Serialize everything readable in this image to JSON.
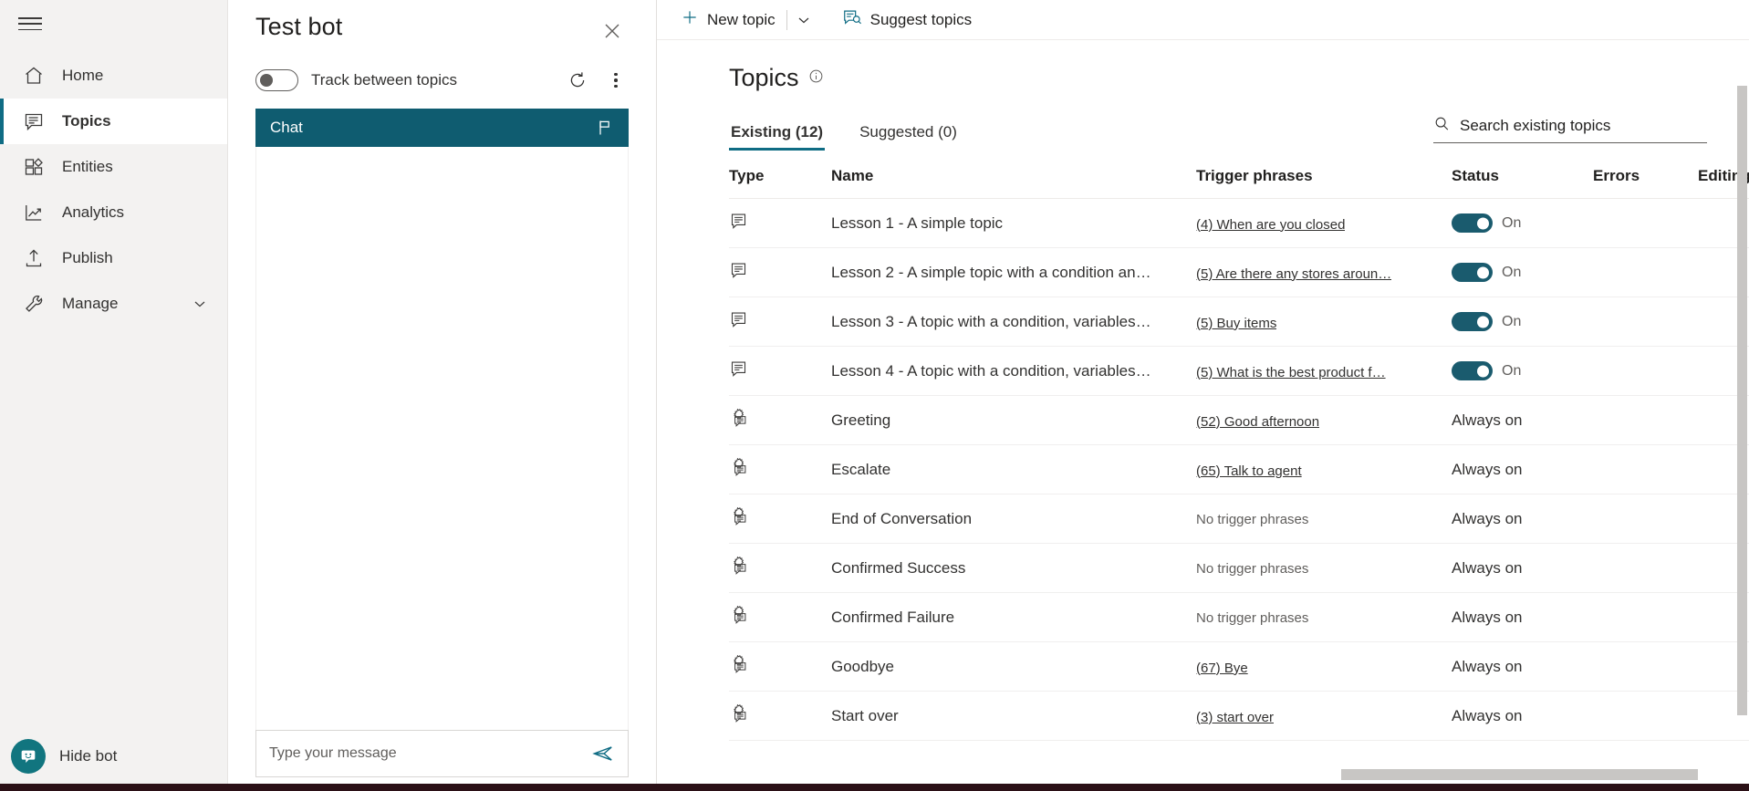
{
  "sidebar": {
    "menu_icon": "hamburger-icon",
    "items": [
      {
        "label": "Home",
        "icon": "home-icon"
      },
      {
        "label": "Topics",
        "icon": "chat-bubble-icon",
        "selected": true
      },
      {
        "label": "Entities",
        "icon": "entities-icon"
      },
      {
        "label": "Analytics",
        "icon": "analytics-icon"
      },
      {
        "label": "Publish",
        "icon": "publish-upload-icon"
      },
      {
        "label": "Manage",
        "icon": "wrench-icon",
        "chevron": "chevron-down-icon"
      }
    ],
    "hide_bot": {
      "label": "Hide bot",
      "icon": "bot-avatar-icon"
    }
  },
  "test_bot": {
    "title": "Test bot",
    "close_icon": "close-icon",
    "track_toggle": {
      "label": "Track between topics",
      "on": false
    },
    "refresh_icon": "refresh-icon",
    "more_icon": "more-vertical-icon",
    "chat_header": {
      "label": "Chat",
      "flag_icon": "flag-icon",
      "bg": "#0f5c70"
    },
    "input": {
      "placeholder": "Type your message",
      "value": "",
      "send_icon": "send-icon"
    }
  },
  "command_bar": {
    "new_topic": {
      "label": "New topic",
      "icon": "plus-icon"
    },
    "new_topic_caret": "chevron-down-icon",
    "suggest_topics": {
      "label": "Suggest topics",
      "icon": "suggest-topics-icon"
    }
  },
  "page": {
    "title": "Topics",
    "info_icon": "info-icon",
    "tabs": [
      {
        "label": "Existing (12)",
        "active": true
      },
      {
        "label": "Suggested (0)",
        "active": false
      }
    ],
    "search": {
      "placeholder": "Search existing topics",
      "value": "",
      "icon": "search-icon"
    }
  },
  "table": {
    "columns": [
      "Type",
      "Name",
      "Trigger phrases",
      "Status",
      "Errors",
      "Editing"
    ],
    "rows": [
      {
        "type_icon": "topic-icon",
        "name": "Lesson 1 - A simple topic",
        "trigger": "(4) When are you closed",
        "trigger_link": true,
        "status_kind": "toggle",
        "status_text": "On",
        "errors": "",
        "editing": ""
      },
      {
        "type_icon": "topic-icon",
        "name": "Lesson 2 - A simple topic with a condition an…",
        "trigger": "(5) Are there any stores aroun…",
        "trigger_link": true,
        "status_kind": "toggle",
        "status_text": "On",
        "errors": "",
        "editing": ""
      },
      {
        "type_icon": "topic-icon",
        "name": "Lesson 3 - A topic with a condition, variables…",
        "trigger": "(5) Buy items",
        "trigger_link": true,
        "status_kind": "toggle",
        "status_text": "On",
        "errors": "",
        "editing": ""
      },
      {
        "type_icon": "topic-icon",
        "name": "Lesson 4 - A topic with a condition, variables…",
        "trigger": "(5) What is the best product f…",
        "trigger_link": true,
        "status_kind": "toggle",
        "status_text": "On",
        "errors": "",
        "editing": ""
      },
      {
        "type_icon": "system-topic-icon",
        "name": "Greeting",
        "trigger": "(52) Good afternoon",
        "trigger_link": true,
        "status_kind": "text",
        "status_text": "Always on",
        "errors": "",
        "editing": ""
      },
      {
        "type_icon": "system-topic-icon",
        "name": "Escalate",
        "trigger": "(65) Talk to agent",
        "trigger_link": true,
        "status_kind": "text",
        "status_text": "Always on",
        "errors": "",
        "editing": ""
      },
      {
        "type_icon": "system-topic-icon",
        "name": "End of Conversation",
        "trigger": "No trigger phrases",
        "trigger_link": false,
        "status_kind": "text",
        "status_text": "Always on",
        "errors": "",
        "editing": ""
      },
      {
        "type_icon": "system-topic-icon",
        "name": "Confirmed Success",
        "trigger": "No trigger phrases",
        "trigger_link": false,
        "status_kind": "text",
        "status_text": "Always on",
        "errors": "",
        "editing": ""
      },
      {
        "type_icon": "system-topic-icon",
        "name": "Confirmed Failure",
        "trigger": "No trigger phrases",
        "trigger_link": false,
        "status_kind": "text",
        "status_text": "Always on",
        "errors": "",
        "editing": ""
      },
      {
        "type_icon": "system-topic-icon",
        "name": "Goodbye",
        "trigger": "(67) Bye",
        "trigger_link": true,
        "status_kind": "text",
        "status_text": "Always on",
        "errors": "",
        "editing": ""
      },
      {
        "type_icon": "system-topic-icon",
        "name": "Start over",
        "trigger": "(3) start over",
        "trigger_link": true,
        "status_kind": "text",
        "status_text": "Always on",
        "errors": "",
        "editing": ""
      }
    ]
  },
  "colors": {
    "accent": "#0f6c84",
    "chat_header_bg": "#0f5c70",
    "toggle_on": "#1a5b6e",
    "nav_bg": "#f3f2f1",
    "bot_avatar": "#11757f"
  }
}
